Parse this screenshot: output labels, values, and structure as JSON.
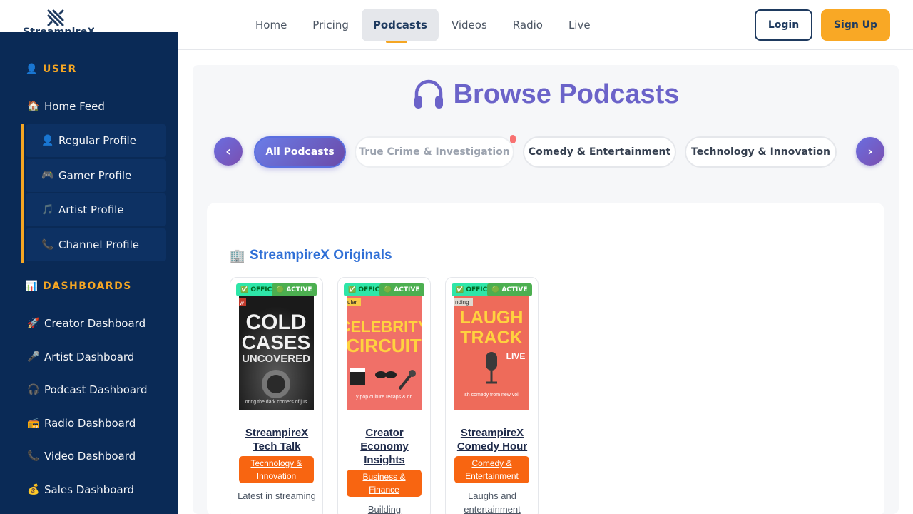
{
  "brand": {
    "name": "StreampireX"
  },
  "nav": {
    "items": [
      {
        "label": "Home",
        "active": false
      },
      {
        "label": "Pricing",
        "active": false
      },
      {
        "label": "Podcasts",
        "active": true
      },
      {
        "label": "Videos",
        "active": false
      },
      {
        "label": "Radio",
        "active": false
      },
      {
        "label": "Live",
        "active": false
      }
    ],
    "login_label": "Login",
    "signup_label": "Sign Up"
  },
  "sidebar": {
    "user_section": {
      "label": "USER",
      "icon": "user-icon"
    },
    "home_feed": {
      "label": "Home Feed",
      "icon": "house-icon"
    },
    "profiles": [
      {
        "label": "Regular Profile",
        "icon": "user-icon"
      },
      {
        "label": "Gamer Profile",
        "icon": "gamepad-icon"
      },
      {
        "label": "Artist Profile",
        "icon": "music-note-icon"
      },
      {
        "label": "Channel Profile",
        "icon": "telephone-icon"
      }
    ],
    "dashboards_section": {
      "label": "DASHBOARDS",
      "icon": "bar-chart-icon"
    },
    "dashboards": [
      {
        "label": "Creator Dashboard",
        "icon": "rocket-icon"
      },
      {
        "label": "Artist Dashboard",
        "icon": "microphone-icon"
      },
      {
        "label": "Podcast Dashboard",
        "icon": "headphones-icon"
      },
      {
        "label": "Radio Dashboard",
        "icon": "radio-icon"
      },
      {
        "label": "Video Dashboard",
        "icon": "telephone-icon"
      },
      {
        "label": "Sales Dashboard",
        "icon": "money-bag-icon"
      }
    ]
  },
  "main": {
    "title": "Browse Podcasts",
    "prev_label": "‹",
    "next_label": "›",
    "categories": [
      {
        "label": "All Podcasts",
        "active": true
      },
      {
        "label": "True Crime & Investigation",
        "active": false
      },
      {
        "label": "Comedy & Entertainment",
        "active": false
      },
      {
        "label": "Technology & Innovation",
        "active": false
      }
    ],
    "section_title": "StreampireX Originals",
    "section_icon": "office-building-icon",
    "cards": [
      {
        "official": "✅ OFFICIAL",
        "status": "🟢 ACTIVE",
        "cover_tag": "w",
        "cover_line1": "COLD",
        "cover_line2": "CASES",
        "cover_line3": "UNCOVERED",
        "cover_caption": "oring the dark corners of jus",
        "title": "StreampireX Tech Talk",
        "category": "Technology & Innovation",
        "description": "Latest in streaming"
      },
      {
        "official": "✅ OFFICIAL",
        "status": "🟢 ACTIVE",
        "cover_tag": "ular",
        "cover_line1": "CELEBRITY",
        "cover_line2": "CIRCUIT",
        "cover_caption": "y pop culture recaps & dr",
        "title": "Creator Economy Insights",
        "category": "Business & Finance",
        "description": "Building"
      },
      {
        "official": "✅ OFFICIAL",
        "status": "🟢 ACTIVE",
        "cover_tag": "nding",
        "cover_line1": "LAUGH",
        "cover_line2": "TRACK",
        "cover_line3": "LIVE",
        "cover_caption": "sh comedy from new voi",
        "title": "StreampireX Comedy Hour",
        "category": "Comedy & Entertainment",
        "description": "Laughs and entertainment"
      }
    ]
  },
  "colors": {
    "sidebar_bg": "#0a2a56",
    "accent": "#f5a623",
    "title_purple": "#6b63c9",
    "category_orange": "#f86511"
  }
}
